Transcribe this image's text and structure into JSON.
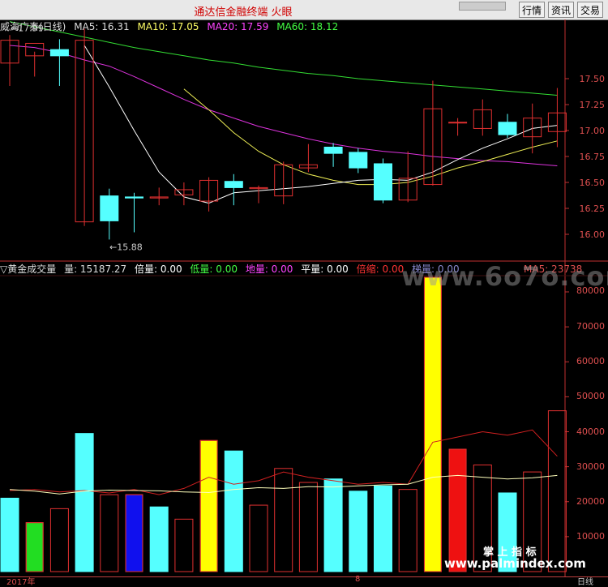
{
  "window": {
    "title": "通达信金融终端 火眼"
  },
  "toolbar": {
    "buttons": [
      "行情",
      "资讯",
      "交易"
    ]
  },
  "price_panel": {
    "name": "威海广泰(日线)",
    "ma": [
      {
        "label": "MA5: 16.31",
        "color": "#ffffff"
      },
      {
        "label": "MA10: 17.05",
        "color": "#ffff66"
      },
      {
        "label": "MA20: 17.59",
        "color": "#ff44ff"
      },
      {
        "label": "MA60: 18.12",
        "color": "#44ff44"
      }
    ],
    "high_label": "17.99",
    "low_label": "15.88",
    "y_ticks": [
      "17.50",
      "17.25",
      "17.00",
      "16.75",
      "16.50",
      "16.25",
      "16.00"
    ]
  },
  "volume_panel": {
    "name": "▽黄金成交量",
    "stats": [
      {
        "label": "量: 15187.27",
        "color": "#dddddd"
      },
      {
        "label": "倍量: 0.00",
        "color": "#ffffff"
      },
      {
        "label": "低量: 0.00",
        "color": "#44ff44"
      },
      {
        "label": "地量: 0.00",
        "color": "#ff44ff"
      },
      {
        "label": "平量: 0.00",
        "color": "#ffffff"
      },
      {
        "label": "倍缩: 0.00",
        "color": "#ff3333"
      },
      {
        "label": "梯量: 0.00",
        "color": "#8888cc"
      }
    ],
    "ma5_label": "MA5: 23738",
    "y_ticks": [
      "80000",
      "70000",
      "60000",
      "50000",
      "40000",
      "30000",
      "20000",
      "10000"
    ]
  },
  "bottom_axis": {
    "year_label": "2017年",
    "marker": "8",
    "period": "日线"
  },
  "watermarks": {
    "site1": "www.6o7o.com",
    "site2": "www.palmindex.com",
    "cn": "掌 上 指 标"
  },
  "chart_data": {
    "type": "candlestick",
    "price_range": [
      15.88,
      17.99
    ],
    "candles": [
      {
        "o": 17.65,
        "h": 17.92,
        "l": 17.43,
        "c": 17.87
      },
      {
        "o": 17.72,
        "h": 17.76,
        "l": 17.52,
        "c": 17.84
      },
      {
        "o": 17.78,
        "h": 17.88,
        "l": 17.43,
        "c": 17.72
      },
      {
        "o": 16.12,
        "h": 17.98,
        "l": 16.08,
        "c": 17.87
      },
      {
        "o": 16.37,
        "h": 16.44,
        "l": 15.95,
        "c": 16.13
      },
      {
        "o": 16.36,
        "h": 16.4,
        "l": 16.02,
        "c": 16.35
      },
      {
        "o": 16.35,
        "h": 16.45,
        "l": 16.28,
        "c": 16.36
      },
      {
        "o": 16.38,
        "h": 16.5,
        "l": 16.28,
        "c": 16.43
      },
      {
        "o": 16.32,
        "h": 16.55,
        "l": 16.22,
        "c": 16.52
      },
      {
        "o": 16.51,
        "h": 16.58,
        "l": 16.28,
        "c": 16.45
      },
      {
        "o": 16.44,
        "h": 16.47,
        "l": 16.3,
        "c": 16.45
      },
      {
        "o": 16.37,
        "h": 16.7,
        "l": 16.29,
        "c": 16.67
      },
      {
        "o": 16.64,
        "h": 16.87,
        "l": 16.6,
        "c": 16.67
      },
      {
        "o": 16.84,
        "h": 16.88,
        "l": 16.65,
        "c": 16.78
      },
      {
        "o": 16.79,
        "h": 16.83,
        "l": 16.59,
        "c": 16.64
      },
      {
        "o": 16.68,
        "h": 16.73,
        "l": 16.3,
        "c": 16.33
      },
      {
        "o": 16.33,
        "h": 16.8,
        "l": 16.31,
        "c": 16.54
      },
      {
        "o": 16.48,
        "h": 17.48,
        "l": 16.47,
        "c": 17.21
      },
      {
        "o": 17.08,
        "h": 17.12,
        "l": 16.95,
        "c": 17.08
      },
      {
        "o": 17.02,
        "h": 17.3,
        "l": 16.95,
        "c": 17.2
      },
      {
        "o": 17.08,
        "h": 17.16,
        "l": 16.93,
        "c": 16.96
      },
      {
        "o": 16.94,
        "h": 17.26,
        "l": 16.78,
        "c": 17.12
      },
      {
        "o": 16.99,
        "h": 17.41,
        "l": 16.84,
        "c": 17.17
      }
    ],
    "ma5": [
      null,
      null,
      null,
      17.82,
      17.42,
      17.0,
      16.6,
      16.36,
      16.3,
      16.4,
      16.42,
      16.44,
      16.46,
      16.49,
      16.52,
      16.53,
      16.52,
      16.6,
      16.72,
      16.83,
      16.92,
      17.02,
      17.05
    ],
    "ma10": [
      null,
      null,
      null,
      null,
      null,
      null,
      null,
      17.4,
      17.2,
      16.98,
      16.8,
      16.67,
      16.58,
      16.52,
      16.48,
      16.48,
      16.5,
      16.56,
      16.64,
      16.7,
      16.77,
      16.84,
      16.9
    ],
    "ma20": [
      17.82,
      17.8,
      17.75,
      17.68,
      17.62,
      17.52,
      17.41,
      17.3,
      17.2,
      17.12,
      17.04,
      16.98,
      16.92,
      16.87,
      16.83,
      16.8,
      16.78,
      16.75,
      16.73,
      16.71,
      16.7,
      16.68,
      16.66
    ],
    "ma60": [
      18.05,
      18.0,
      17.95,
      17.9,
      17.85,
      17.8,
      17.76,
      17.72,
      17.68,
      17.65,
      17.61,
      17.58,
      17.55,
      17.53,
      17.5,
      17.48,
      17.46,
      17.44,
      17.42,
      17.4,
      17.38,
      17.36,
      17.34
    ],
    "volume_ylim": [
      0,
      85000
    ],
    "volume": [
      {
        "v": 21000,
        "kind": "up"
      },
      {
        "v": 14000,
        "kind": "green"
      },
      {
        "v": 18000,
        "kind": "down"
      },
      {
        "v": 39500,
        "kind": "up"
      },
      {
        "v": 22000,
        "kind": "down"
      },
      {
        "v": 22000,
        "kind": "blue"
      },
      {
        "v": 18500,
        "kind": "up"
      },
      {
        "v": 15000,
        "kind": "down"
      },
      {
        "v": 37500,
        "kind": "yellow"
      },
      {
        "v": 34500,
        "kind": "up"
      },
      {
        "v": 19000,
        "kind": "down"
      },
      {
        "v": 29500,
        "kind": "down"
      },
      {
        "v": 25500,
        "kind": "down"
      },
      {
        "v": 26500,
        "kind": "up"
      },
      {
        "v": 23000,
        "kind": "up"
      },
      {
        "v": 24500,
        "kind": "up"
      },
      {
        "v": 23500,
        "kind": "down"
      },
      {
        "v": 86000,
        "kind": "yellow"
      },
      {
        "v": 35000,
        "kind": "red"
      },
      {
        "v": 30500,
        "kind": "down"
      },
      {
        "v": 22500,
        "kind": "up"
      },
      {
        "v": 28500,
        "kind": "down"
      },
      {
        "v": 46000,
        "kind": "down"
      }
    ],
    "vol_ma5": [
      23500,
      23000,
      22200,
      23000,
      23300,
      23200,
      23100,
      22800,
      22600,
      23500,
      24000,
      23800,
      24300,
      24200,
      24500,
      24800,
      25000,
      27000,
      27500,
      27000,
      26500,
      26800,
      27500
    ],
    "vol_ma10": [
      23200,
      23500,
      22800,
      23200,
      22500,
      23500,
      22000,
      23800,
      27000,
      25000,
      26000,
      28500,
      27000,
      26000,
      25000,
      25500,
      25000,
      37000,
      38500,
      40000,
      39000,
      40500,
      33000
    ]
  }
}
